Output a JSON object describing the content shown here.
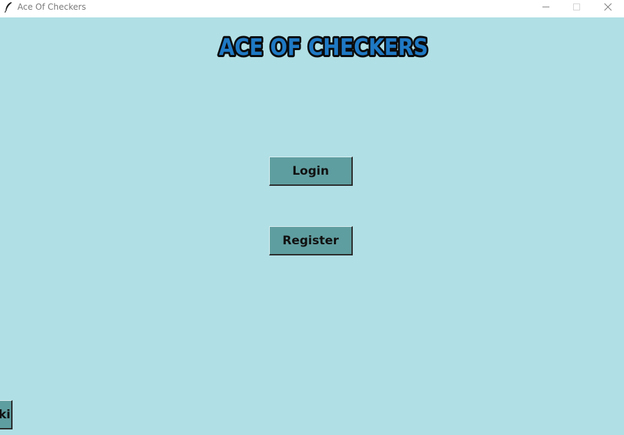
{
  "window": {
    "title": "Ace Of Checkers",
    "icon": "feather-icon",
    "controls": [
      "minimize-icon",
      "maximize-icon",
      "close-icon"
    ]
  },
  "header": {
    "logo_text": "ACE OF CHECKERS"
  },
  "menu": {
    "login_label": "Login",
    "register_label": "Register",
    "corner_button_label": "ki"
  },
  "colors": {
    "background": "#b0dfe5",
    "button": "#5f9ea0",
    "logo_fill": "#1f79c4",
    "logo_outline": "#0b0b0b"
  }
}
